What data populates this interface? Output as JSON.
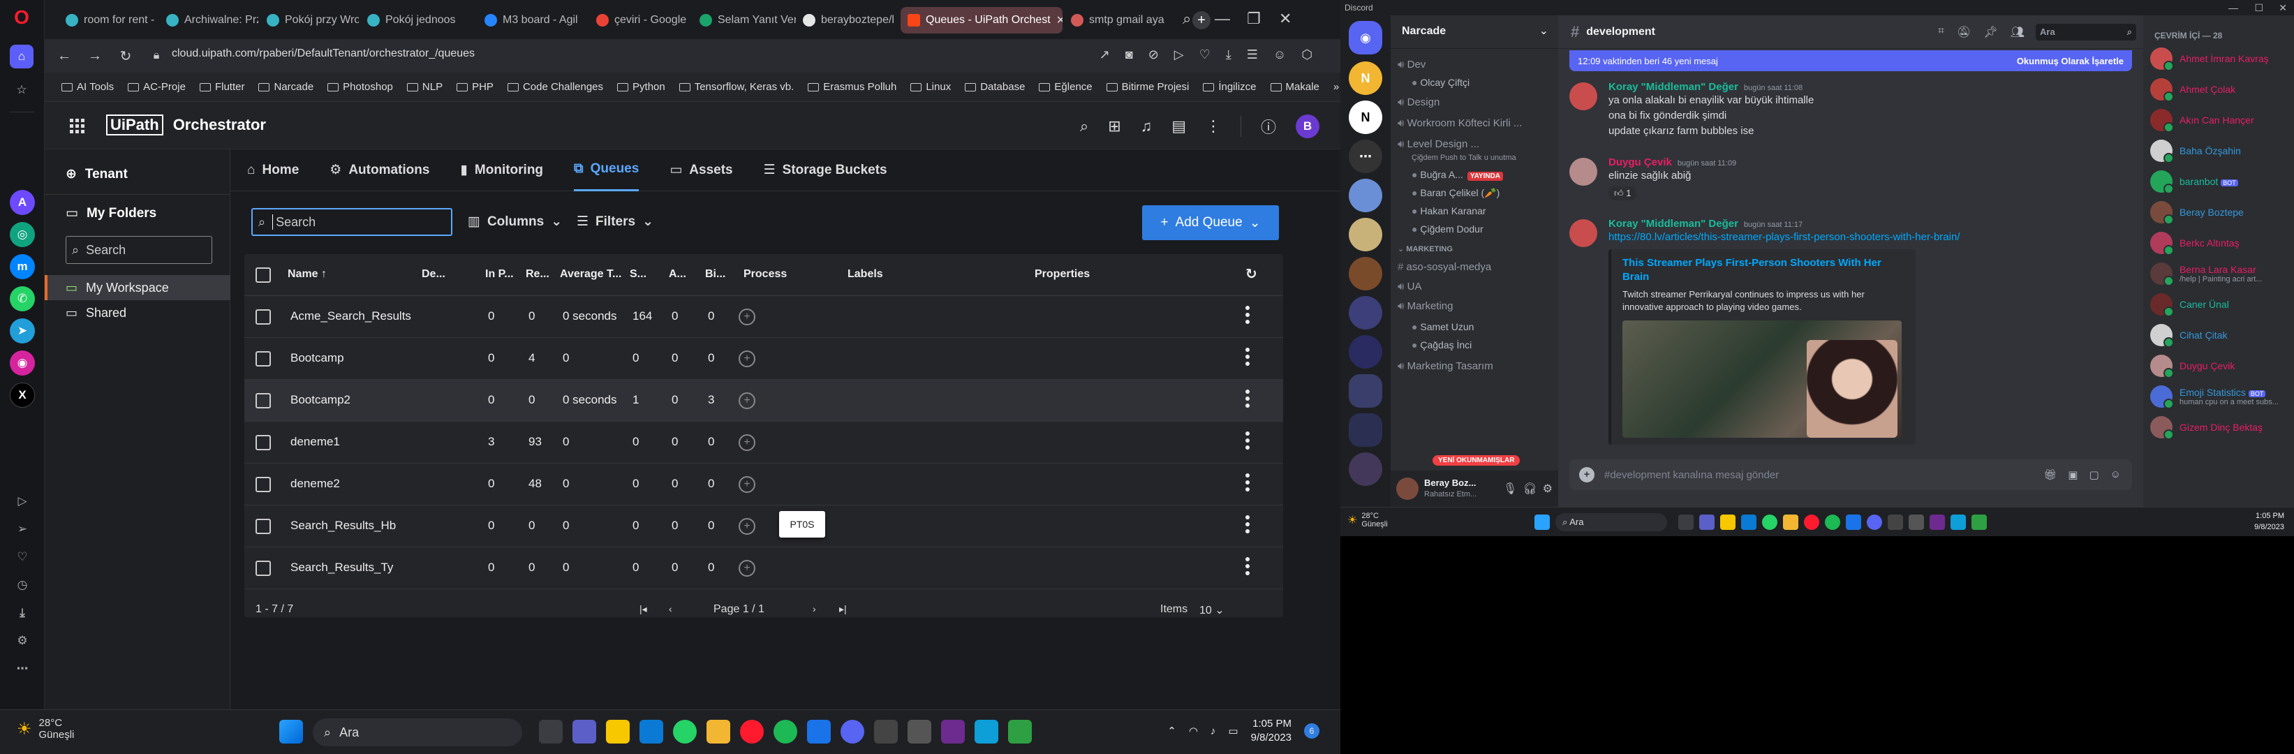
{
  "opera": {
    "tabs": [
      {
        "label": "room for rent -",
        "color": "#37b3c4"
      },
      {
        "label": "Archiwalne: Prz",
        "color": "#37b3c4"
      },
      {
        "label": "Pokój przy Wro",
        "color": "#37b3c4"
      },
      {
        "label": "Pokój jednoos",
        "color": "#37b3c4"
      },
      {
        "label": "M3 board - Agil",
        "color": "#2684ff"
      },
      {
        "label": "çeviri - Google",
        "color": "#ea4335"
      },
      {
        "label": "Selam Yanıt Ver",
        "color": "#1aa36b"
      },
      {
        "label": "berayboztepe/l",
        "color": "#e6e6e6"
      },
      {
        "label": "Queues - UiPath Orchest",
        "color": "#fa4616",
        "active": true
      },
      {
        "label": "smtp gmail aya",
        "color": "#d25a56"
      }
    ],
    "new_tab": "+",
    "url": "cloud.uipath.com/rpaberi/DefaultTenant/orchestrator_/queues",
    "bookmarks": [
      "AI Tools",
      "AC-Proje",
      "Flutter",
      "Narcade",
      "Photoshop",
      "NLP",
      "PHP",
      "Code Challenges",
      "Python",
      "Tensorflow, Keras vb.",
      "Erasmus Polluh",
      "Linux",
      "Database",
      "Eğlence",
      "Bitirme Projesi",
      "İngilizce",
      "Makale"
    ],
    "accent": "#ff1b2d"
  },
  "uipath": {
    "brand": "UiPath",
    "product": "Orchestrator",
    "avatar": "B",
    "tenant": "Tenant",
    "my_folders": "My Folders",
    "folder_search": "Search",
    "folders": [
      "My Workspace",
      "Shared"
    ],
    "nav": [
      "Home",
      "Automations",
      "Monitoring",
      "Queues",
      "Assets",
      "Storage Buckets"
    ],
    "search_placeholder": "Search",
    "columns_label": "Columns",
    "filters_label": "Filters",
    "add_queue_label": "Add Queue",
    "headers": [
      "Name",
      "De...",
      "In P...",
      "Re...",
      "Average T...",
      "S...",
      "A...",
      "Bi...",
      "Process",
      "Labels",
      "Properties"
    ],
    "rows": [
      {
        "name": "Acme_Search_Results",
        "inp": "0",
        "re": "0",
        "avg": "0 seconds",
        "s": "164",
        "a": "0",
        "bi": "0"
      },
      {
        "name": "Bootcamp",
        "inp": "0",
        "re": "4",
        "avg": "0",
        "s": "0",
        "a": "0",
        "bi": "0"
      },
      {
        "name": "Bootcamp2",
        "inp": "0",
        "re": "0",
        "avg": "0 seconds",
        "s": "1",
        "a": "0",
        "bi": "3"
      },
      {
        "name": "deneme1",
        "inp": "3",
        "re": "93",
        "avg": "0",
        "s": "0",
        "a": "0",
        "bi": "0"
      },
      {
        "name": "deneme2",
        "inp": "0",
        "re": "48",
        "avg": "0",
        "s": "0",
        "a": "0",
        "bi": "0"
      },
      {
        "name": "Search_Results_Hb",
        "inp": "0",
        "re": "0",
        "avg": "0",
        "s": "0",
        "a": "0",
        "bi": "0"
      },
      {
        "name": "Search_Results_Ty",
        "inp": "0",
        "re": "0",
        "avg": "0",
        "s": "0",
        "a": "0",
        "bi": "0"
      }
    ],
    "tooltip": "PT0S",
    "range_label": "1 - 7 / 7",
    "page_label": "Page 1 / 1",
    "items_label": "Items",
    "items_value": "10",
    "accent": "#2f7de1"
  },
  "taskbar1": {
    "temp": "28°C",
    "weather": "Güneşli",
    "search": "Ara",
    "time": "1:05 PM",
    "date": "9/8/2023",
    "notif": "6"
  },
  "discord": {
    "app_title": "Discord",
    "server": "Narcade",
    "channel": "development",
    "search": "Ara",
    "newbar_text": "12:09 vaktinden beri 46 yeni mesaj",
    "newbar_action": "Okunmuş Olarak İşaretle",
    "channels": [
      {
        "label": "Dev",
        "kind": "cat"
      },
      {
        "label": "Olcay Çiftçi",
        "kind": "user"
      },
      {
        "label": "Design",
        "kind": "cat"
      },
      {
        "label": "Workroom Köfteci Kirli ...",
        "kind": "cat"
      },
      {
        "label": "Level Design ...",
        "kind": "cat"
      },
      {
        "label": "Çiğdem Push to Talk u unutma",
        "kind": "note"
      },
      {
        "label": "Buğra A...",
        "kind": "user",
        "live": "YAYINDA"
      },
      {
        "label": "Baran Çelikel (🥕)",
        "kind": "user"
      },
      {
        "label": "Hakan Karanar",
        "kind": "user"
      },
      {
        "label": "Çiğdem Dodur",
        "kind": "user"
      },
      {
        "label": "MARKETING",
        "kind": "section"
      },
      {
        "label": "aso-sosyal-medya",
        "kind": "text"
      },
      {
        "label": "UA",
        "kind": "cat"
      },
      {
        "label": "Marketing",
        "kind": "cat"
      },
      {
        "label": "Samet Uzun",
        "kind": "user"
      },
      {
        "label": "Çağdaş İnci",
        "kind": "user"
      },
      {
        "label": "Marketing Tasarım",
        "kind": "cat"
      }
    ],
    "unread_pill": "YENİ OKUNMAMIŞLAR",
    "user_name": "Beray Boz...",
    "user_status": "Rahatsız Etm...",
    "messages": [
      {
        "author": "Koray \"Middleman\" Değer",
        "time": "bugün saat 11:08",
        "color": "#1abc9c",
        "lines": [
          "ya onla alakalı bi enayilik var büyük ihtimalle",
          "ona bi fix gönderdik şimdi",
          "update çıkarız farm bubbles ise"
        ]
      },
      {
        "author": "Duygu Çevik",
        "time": "bugün saat 11:09",
        "color": "#e91e63",
        "lines": [
          "elinzie sağlık abiğ"
        ],
        "reaction": "1"
      },
      {
        "author": "Koray \"Middleman\" Değer",
        "time": "bugün saat 11:17",
        "color": "#1abc9c",
        "lines": [
          "https://80.lv/articles/this-streamer-plays-first-person-shooters-with-her-brain/"
        ],
        "embed_title": "This Streamer Plays First-Person Shooters With Her Brain",
        "embed_desc": "Twitch streamer Perrikaryal continues to impress us with her innovative approach to playing video games."
      }
    ],
    "input_placeholder": "#development kanalına mesaj gönder",
    "members_header": "ÇEVRİM İÇİ — 28",
    "members": [
      {
        "name": "Ahmet İmran Kavraş",
        "color": "#e91e63"
      },
      {
        "name": "Ahmet Çolak",
        "color": "#e91e63"
      },
      {
        "name": "Akın Can Hançer",
        "color": "#e91e63"
      },
      {
        "name": "Baha Özşahin",
        "color": "#3498db"
      },
      {
        "name": "baranbot",
        "color": "#1abc9c",
        "bot": "BOT"
      },
      {
        "name": "Beray Boztepe",
        "color": "#3498db"
      },
      {
        "name": "Berkc Altıntaş",
        "color": "#e91e63"
      },
      {
        "name": "Berna Lara Kasar",
        "color": "#e91e63",
        "sub": "/help | Painting acri art..."
      },
      {
        "name": "Caner Ünal",
        "color": "#1abc9c"
      },
      {
        "name": "Cihat Çitak",
        "color": "#3498db"
      },
      {
        "name": "Duygu Çevik",
        "color": "#e91e63"
      },
      {
        "name": "Emoji Statistics",
        "color": "#3498db",
        "bot": "BOT",
        "sub": "human cpu on a meet subs..."
      },
      {
        "name": "Gizem Dinç Bektaş",
        "color": "#e91e63"
      }
    ]
  },
  "taskbar2": {
    "temp": "28°C",
    "weather": "Güneşli",
    "search": "Ara",
    "time": "1:05 PM",
    "date": "9/8/2023"
  }
}
